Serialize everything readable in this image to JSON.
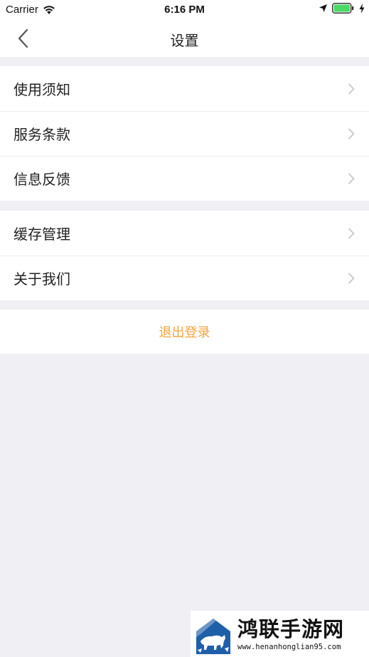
{
  "status_bar": {
    "carrier": "Carrier",
    "time": "6:16 PM"
  },
  "nav": {
    "title": "设置",
    "back_icon": "chevron-left-icon"
  },
  "groups": [
    {
      "items": [
        {
          "label": "使用须知"
        },
        {
          "label": "服务条款"
        },
        {
          "label": "信息反馈"
        }
      ]
    },
    {
      "items": [
        {
          "label": "缓存管理"
        },
        {
          "label": "关于我们"
        }
      ]
    }
  ],
  "logout": {
    "label": "退出登录"
  },
  "watermark": {
    "title": "鸿联手游网",
    "url": "www.henanhonglian95.com"
  },
  "colors": {
    "accent": "#f7a23a",
    "background": "#efeff4",
    "battery": "#4cd964",
    "watermark_blue": "#1f5fa8"
  }
}
